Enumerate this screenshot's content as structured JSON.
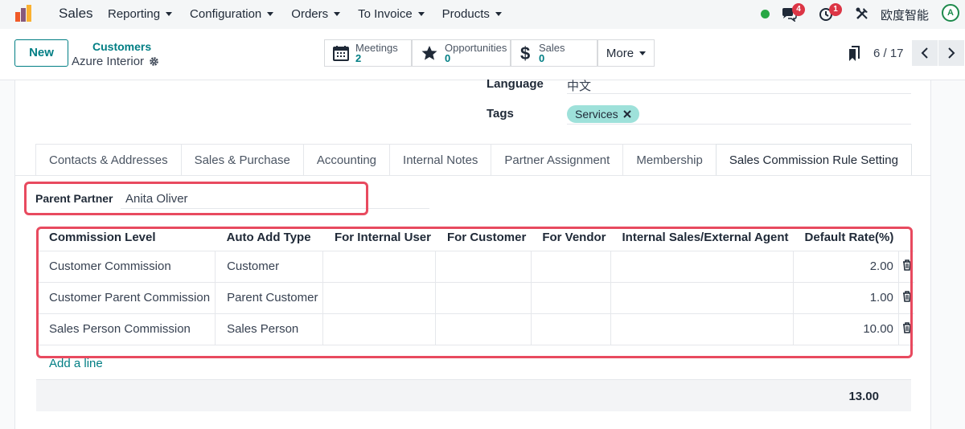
{
  "navbar": {
    "app_name": "Sales",
    "menu": [
      "Reporting",
      "Configuration",
      "Orders",
      "To Invoice",
      "Products"
    ],
    "messages_badge": "4",
    "activities_badge": "1",
    "company": "欧度智能",
    "avatar_text": "A"
  },
  "control": {
    "new_label": "New",
    "breadcrumb_parent": "Customers",
    "breadcrumb_current": "Azure Interior",
    "stats": [
      {
        "label": "Meetings",
        "value": "2",
        "icon": "calendar-icon"
      },
      {
        "label": "Opportunities",
        "value": "0",
        "icon": "star-icon"
      },
      {
        "label": "Sales",
        "value": "0",
        "icon": "dollar-icon"
      }
    ],
    "more_label": "More",
    "pager": "6 / 17"
  },
  "form": {
    "language_label": "Language",
    "language_value": "中文",
    "tags_label": "Tags",
    "tag_value": "Services",
    "parent_partner_label": "Parent Partner",
    "parent_partner_value": "Anita Oliver"
  },
  "tabs": [
    "Contacts & Addresses",
    "Sales & Purchase",
    "Accounting",
    "Internal Notes",
    "Partner Assignment",
    "Membership",
    "Sales Commission Rule Setting"
  ],
  "table": {
    "columns": [
      "Commission Level",
      "Auto Add Type",
      "For Internal User",
      "For Customer",
      "For Vendor",
      "Internal Sales/External Agent",
      "Default Rate(%)"
    ],
    "rows": [
      {
        "level": "Customer Commission",
        "type": "Customer",
        "internal": "",
        "customer": "",
        "vendor": "",
        "agent": "",
        "rate": "2.00"
      },
      {
        "level": "Customer Parent Commission",
        "type": "Parent Customer",
        "internal": "",
        "customer": "",
        "vendor": "",
        "agent": "",
        "rate": "1.00"
      },
      {
        "level": "Sales Person Commission",
        "type": "Sales Person",
        "internal": "",
        "customer": "",
        "vendor": "",
        "agent": "",
        "rate": "10.00"
      }
    ],
    "add_line": "Add a line",
    "total": "13.00"
  },
  "colors": {
    "accent": "#017e84",
    "highlight": "#e84a5f",
    "tag_bg": "#9ee1da",
    "online": "#28a745",
    "badge": "#dc3545"
  }
}
